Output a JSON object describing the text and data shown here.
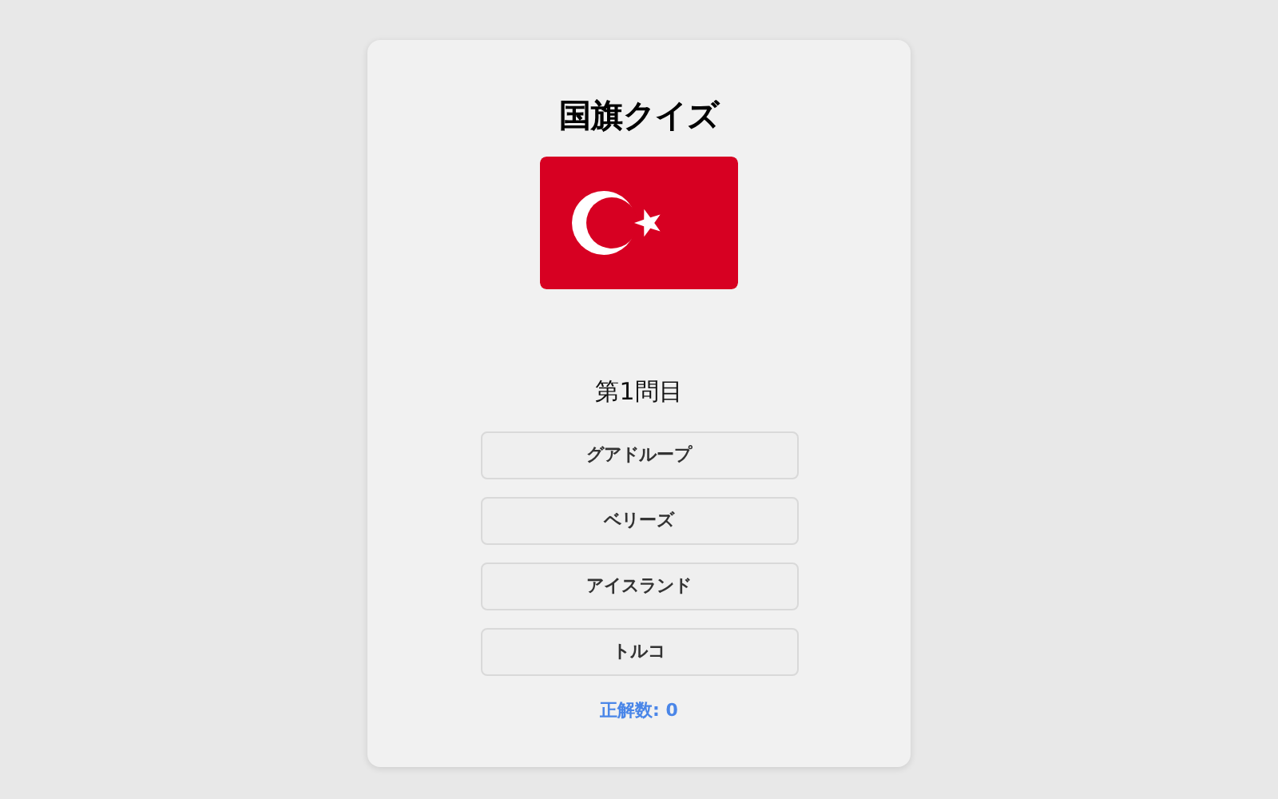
{
  "title": "国旗クイズ",
  "question": "第1問目",
  "options": [
    {
      "label": "グアドループ"
    },
    {
      "label": "ベリーズ"
    },
    {
      "label": "アイスランド"
    },
    {
      "label": "トルコ"
    }
  ],
  "score": "正解数: 0"
}
